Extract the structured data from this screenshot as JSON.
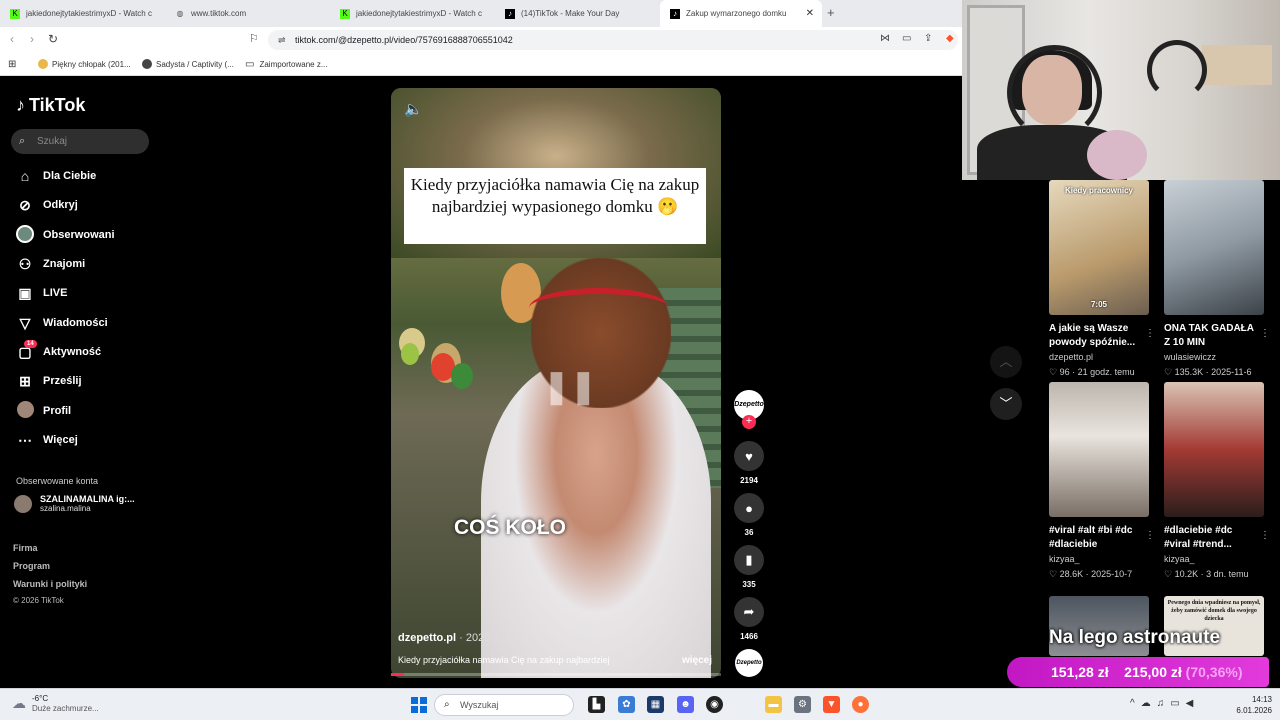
{
  "browser": {
    "tabs": [
      {
        "title": "jakiedonejtytakiestrimyxD - Watch c",
        "icon": "kick-icon"
      },
      {
        "title": "www.tiktok.com",
        "icon": "globe-icon"
      },
      {
        "title": "jakiedonejtytakiestrimyxD - Watch c",
        "icon": "kick-icon"
      },
      {
        "title": "(14)TikTok - Make Your Day",
        "icon": "tiktok-icon"
      },
      {
        "title": "Zakup wymarzonego domku",
        "icon": "tiktok-icon",
        "active": true
      }
    ],
    "url": "tiktok.com/@dzepetto.pl/video/7576916888706551042",
    "bookmarks": [
      "Piękny chłopak (201...",
      "Sadysta / Captivity (...",
      "Zaimportowane z..."
    ]
  },
  "sidebar": {
    "logo": "TikTok",
    "search_placeholder": "Szukaj",
    "nav": [
      {
        "label": "Dla Ciebie",
        "icon": "home-icon"
      },
      {
        "label": "Odkryj",
        "icon": "compass-icon"
      },
      {
        "label": "Obserwowani",
        "icon": "avatar-icon"
      },
      {
        "label": "Znajomi",
        "icon": "friends-icon"
      },
      {
        "label": "LIVE",
        "icon": "live-icon"
      },
      {
        "label": "Wiadomości",
        "icon": "send-icon"
      },
      {
        "label": "Aktywność",
        "icon": "inbox-icon",
        "badge": "14"
      },
      {
        "label": "Prześlij",
        "icon": "plus-square-icon"
      },
      {
        "label": "Profil",
        "icon": "profile-avatar-icon"
      },
      {
        "label": "Więcej",
        "icon": "more-icon"
      }
    ],
    "following_title": "Obserwowane konta",
    "following_account": {
      "name": "SZALINAMALINA ig:...",
      "handle": "szalina.malina"
    },
    "footer": [
      "Firma",
      "Program",
      "Warunki i polityki",
      "© 2026 TikTok"
    ]
  },
  "video": {
    "caption_overlay": "Kiedy przyjaciółka namawia Cię na zakup najbardziej wypasionego domku 🫢",
    "subtitle": "COŚ KOŁO",
    "author": "dzepetto.pl",
    "date": "· 2025-11-26",
    "description": "Kiedy przyjaciółka namawia Cię na zakup najbardziej",
    "more": "więcej",
    "progress": 0.04,
    "avatar_text": "Dzepetto",
    "actions": {
      "likes": "2194",
      "comments": "36",
      "saves": "335",
      "shares": "1466"
    }
  },
  "recommendations": [
    {
      "title": "A jakie są Wasze powody spóźnie...",
      "author": "dzepetto.pl",
      "likes": "96",
      "date": "21 godz. temu",
      "overlay": "Kiedy pracownicy",
      "duration": "7:05",
      "color": "#c9b48c"
    },
    {
      "title": "ONA TAK GADAŁA Z 10 MIN",
      "author": "wulasiewiczz",
      "likes": "135.3K",
      "date": "2025-11-6",
      "overlay": "",
      "duration": "",
      "color": "#8f9aa3"
    },
    {
      "title": "#viral #alt #bi #dc #dlaciebie",
      "author": "kizyaa_",
      "likes": "28.6K",
      "date": "2025-10-7",
      "overlay": "",
      "duration": "",
      "color": "#9a8f86"
    },
    {
      "title": "#dlaciebie #dc #viral #trend...",
      "author": "kizyaa_",
      "likes": "10.2K",
      "date": "3 dn. temu",
      "overlay": "",
      "duration": "",
      "color": "#7a3a35"
    },
    {
      "title": "",
      "author": "",
      "likes": "",
      "date": "",
      "overlay": "",
      "duration": "",
      "color": "#5b6470"
    },
    {
      "title": "",
      "author": "",
      "likes": "",
      "date": "",
      "overlay": "Pewnego dnia wpadniesz na pomysł, żeby zamówić domek dla swojego dziecka",
      "duration": "",
      "color": "#c8c2b6"
    }
  ],
  "donation": {
    "title": "Na lego astronaute",
    "current": "151,28 zł",
    "goal": "215,00 zł",
    "percent": "(70,36%)",
    "value": 0.7036
  },
  "taskbar": {
    "weather_temp": "-6°C",
    "weather_desc": "Duże zachmurze...",
    "search_placeholder": "Wyszukaj",
    "time": "14:13",
    "date": "6.01.2026"
  }
}
